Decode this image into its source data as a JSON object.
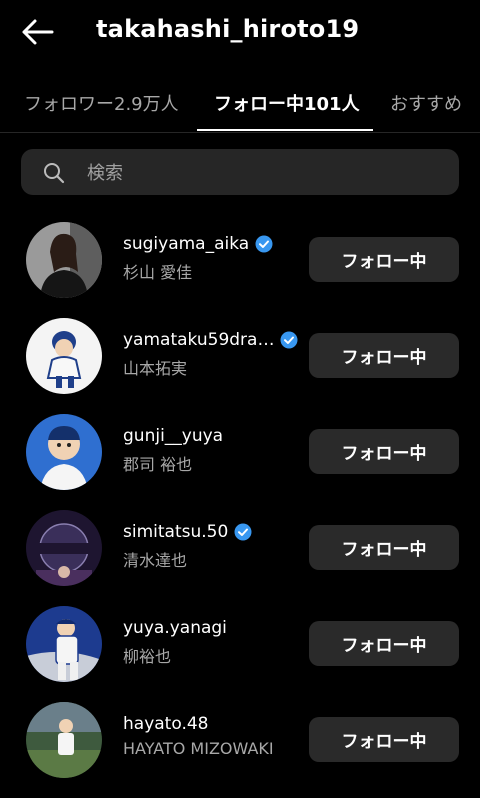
{
  "header": {
    "title": "takahashi_hiroto19",
    "back_icon": "arrow-left-icon"
  },
  "tabs": [
    {
      "label": "フォロワー2.9万人",
      "active": false
    },
    {
      "label": "フォロー中101人",
      "active": true
    },
    {
      "label": "おすすめ",
      "active": false
    }
  ],
  "search": {
    "placeholder": "検索",
    "icon": "search-icon"
  },
  "colors": {
    "background": "#000000",
    "button_bg": "#2a2a2a",
    "verified_blue": "#3897f0",
    "secondary_text": "#a8a8a8"
  },
  "users": [
    {
      "username": "sugiyama_aika",
      "full_name": "杉山 愛佳",
      "verified": true,
      "button": "フォロー中"
    },
    {
      "username": "yamataku59dra…",
      "full_name": "山本拓実",
      "verified": true,
      "button": "フォロー中"
    },
    {
      "username": "gunji__yuya",
      "full_name": "郡司 裕也",
      "verified": false,
      "button": "フォロー中"
    },
    {
      "username": "simitatsu.50",
      "full_name": "清水達也",
      "verified": true,
      "button": "フォロー中"
    },
    {
      "username": "yuya.yanagi",
      "full_name": "柳裕也",
      "verified": false,
      "button": "フォロー中"
    },
    {
      "username": "hayato.48",
      "full_name": "HAYATO MIZOWAKI",
      "verified": false,
      "button": "フォロー中"
    }
  ]
}
